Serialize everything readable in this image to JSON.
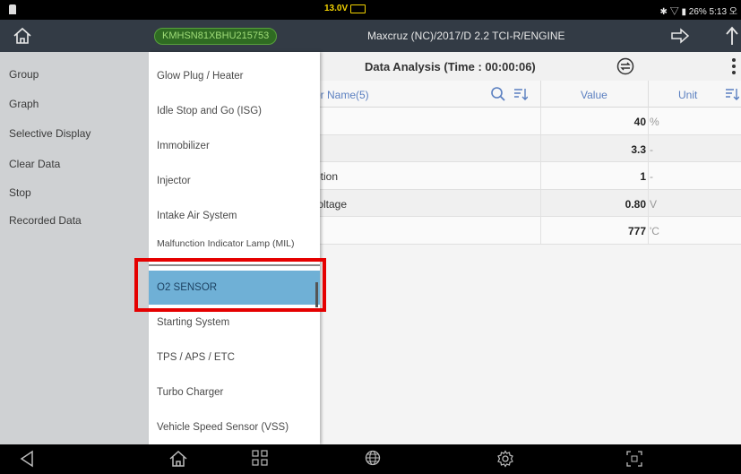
{
  "status_bar": {
    "voltage": "13.0V",
    "right_text": "✱ ▽ ▮ 26% 5:13 오"
  },
  "header": {
    "vin": "KMHSN81XBHU215753",
    "vehicle": "Maxcruz (NC)/2017/D 2.2 TCI-R/ENGINE"
  },
  "sidebar": {
    "items": [
      {
        "label": "Group"
      },
      {
        "label": "Graph"
      },
      {
        "label": "Selective Display"
      },
      {
        "label": "Clear Data"
      },
      {
        "label": "Stop"
      },
      {
        "label": "Recorded Data"
      }
    ]
  },
  "panel": {
    "title": "Data Analysis (Time : 00:00:06)",
    "col_name": "or Name(5)",
    "col_value": "Value",
    "col_unit": "Unit",
    "rows": [
      {
        "name": "",
        "value": "40",
        "unit": "%"
      },
      {
        "name": "",
        "value": "3.3",
        "unit": "-"
      },
      {
        "name": "ption",
        "value": "1",
        "unit": "-"
      },
      {
        "name": "/oltage",
        "value": "0.80",
        "unit": "V"
      },
      {
        "name": "",
        "value": "777",
        "unit": "'C"
      }
    ]
  },
  "dropdown": {
    "items": [
      {
        "label": "Glow Plug / Heater"
      },
      {
        "label": "Idle Stop and Go (ISG)"
      },
      {
        "label": "Immobilizer"
      },
      {
        "label": "Injector"
      },
      {
        "label": "Intake Air System"
      },
      {
        "label": "Malfunction Indicator Lamp (MIL)"
      },
      {
        "label": "O2 SENSOR"
      },
      {
        "label": "Starting System"
      },
      {
        "label": "TPS / APS / ETC"
      },
      {
        "label": "Turbo Charger"
      },
      {
        "label": "Vehicle Speed Sensor (VSS)"
      }
    ],
    "selected": "O2 SENSOR"
  },
  "colors": {
    "header_bg": "#333b45",
    "selected_item": "#6fb0d6",
    "highlight_box": "#e50000",
    "vin_badge": "#2f6b22"
  },
  "icons": {
    "home": "home-icon",
    "next": "arrow-right-icon",
    "up": "upload-icon",
    "search": "search-icon",
    "sort": "sort-icon",
    "more": "more-vertical-icon",
    "nav": [
      "back-icon",
      "home-icon",
      "apps-icon",
      "globe-icon",
      "settings-icon",
      "screenshot-icon"
    ]
  }
}
